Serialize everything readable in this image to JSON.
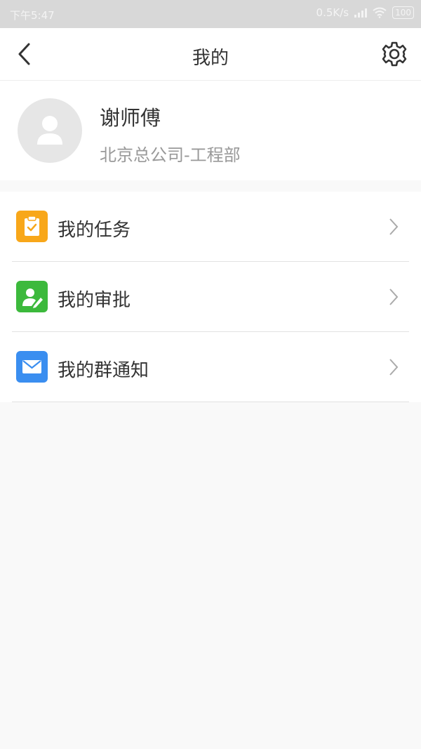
{
  "status_bar": {
    "time": "下午5:47",
    "network_speed": "0.5K/s",
    "battery": "100",
    "icons": [
      "signal-icon",
      "wifi-icon",
      "battery-icon"
    ]
  },
  "header": {
    "title": "我的",
    "back_icon": "back-arrow-icon",
    "settings_icon": "gear-icon"
  },
  "profile": {
    "name": "谢师傅",
    "department": "北京总公司-工程部",
    "avatar_icon": "avatar-placeholder-icon"
  },
  "menu": {
    "items": [
      {
        "label": "我的任务",
        "icon": "clipboard-check-icon",
        "color": "#f8a71a"
      },
      {
        "label": "我的审批",
        "icon": "approval-pen-icon",
        "color": "#3cb93c"
      },
      {
        "label": "我的群通知",
        "icon": "envelope-icon",
        "color": "#3a8ef0"
      }
    ]
  },
  "colors": {
    "status_bar_bg": "#d8d8d8",
    "page_bg": "#f9f9f9",
    "text_primary": "#333333",
    "text_secondary": "#999999"
  }
}
